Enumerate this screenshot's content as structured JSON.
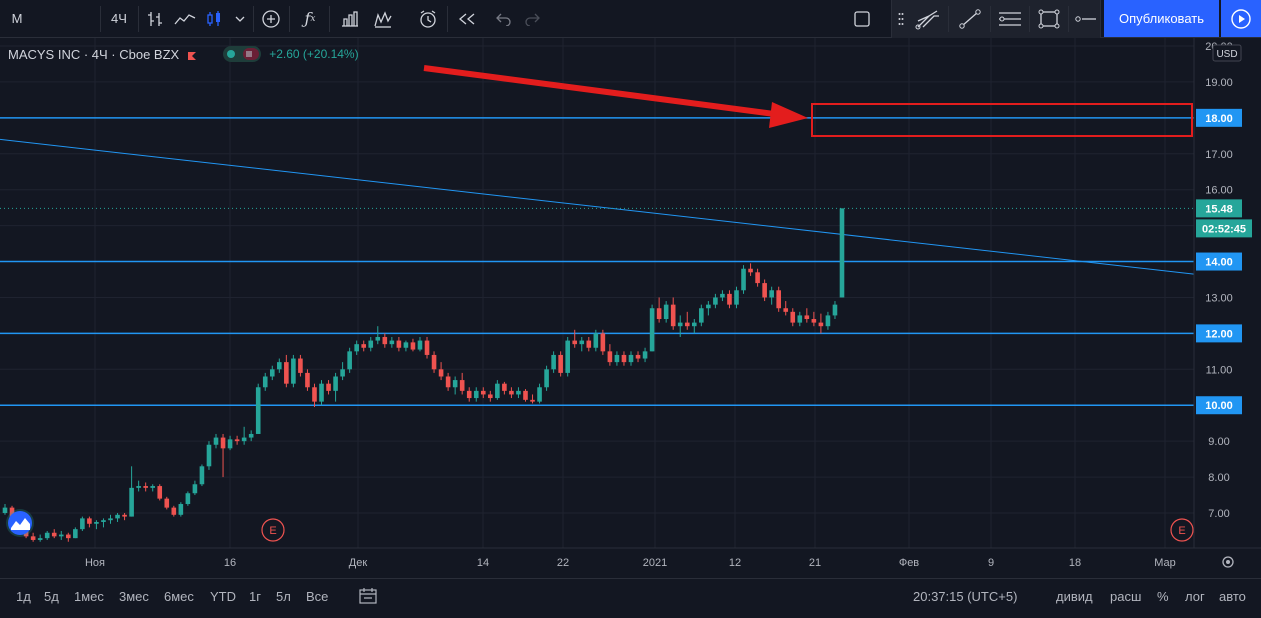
{
  "toolbar": {
    "symbol": "M",
    "interval": "4Ч",
    "publish_label": "Опубликовать",
    "icons": [
      "bar-style-icon",
      "line-style-icon",
      "candle-style-icon",
      "chevron-down-icon",
      "add-compare-icon",
      "indicators-icon",
      "financials-icon",
      "alert-icon",
      "alarm-clock-icon",
      "replay-icon",
      "undo-icon",
      "redo-icon",
      "square-icon"
    ]
  },
  "drawing_toolbar": {
    "icons": [
      "drag-handle-icon",
      "pitchfork-icon",
      "trendline-icon",
      "horizontal-ray-icon",
      "rectangle-icon",
      "horizontal-line-icon"
    ]
  },
  "legend": {
    "title": "MACYS INC · 4Ч · Cboe BZX",
    "change": "+2.60 (+20.14%)"
  },
  "price_axis": {
    "currency": "USD",
    "labels": [
      "20.00",
      "19.00",
      "18.00",
      "17.00",
      "16.00",
      "15.48",
      "14.00",
      "13.00",
      "12.00",
      "11.00",
      "10.00",
      "9.00",
      "8.00",
      "7.00"
    ],
    "last_price": "15.48",
    "countdown": "02:52:45",
    "highlighted": [
      "18.00",
      "14.00",
      "12.00",
      "10.00"
    ]
  },
  "time_axis": {
    "labels": [
      "Ноя",
      "16",
      "Дек",
      "14",
      "22",
      "2021",
      "12",
      "21",
      "Фев",
      "9",
      "18",
      "Мар"
    ]
  },
  "earnings_marker": "E",
  "bottom": {
    "ranges": [
      "1д",
      "5д",
      "1мес",
      "3мес",
      "6мес",
      "YTD",
      "1г",
      "5л",
      "Все"
    ],
    "time": "20:37:15 (UTC+5)",
    "options": [
      "дивид",
      "расш",
      "%",
      "лог",
      "авто"
    ]
  },
  "colors": {
    "background": "#131722",
    "up": "#26a69a",
    "down": "#ef5350",
    "level_line": "#2196f3",
    "annotation": "#e31d1d",
    "accent": "#2962ff"
  },
  "chart_data": {
    "type": "candlestick",
    "ylim": [
      6.2,
      20.3
    ],
    "horizontal_levels": [
      18.0,
      14.0,
      12.0,
      10.0
    ],
    "trend_line": [
      {
        "x": "Nov 2",
        "y": 17.4
      },
      {
        "x": "Feb 26",
        "y": 13.65
      }
    ],
    "last_price": 15.48,
    "candles": [
      [
        7.0,
        7.25,
        6.95,
        7.15
      ],
      [
        7.15,
        7.2,
        6.6,
        6.75
      ],
      [
        6.75,
        6.9,
        6.55,
        6.65
      ],
      [
        6.6,
        6.7,
        6.3,
        6.35
      ],
      [
        6.35,
        6.45,
        6.2,
        6.25
      ],
      [
        6.25,
        6.4,
        6.2,
        6.3
      ],
      [
        6.3,
        6.5,
        6.25,
        6.45
      ],
      [
        6.45,
        6.55,
        6.3,
        6.35
      ],
      [
        6.35,
        6.5,
        6.25,
        6.4
      ],
      [
        6.4,
        6.45,
        6.2,
        6.3
      ],
      [
        6.3,
        6.6,
        6.3,
        6.55
      ],
      [
        6.55,
        6.9,
        6.5,
        6.85
      ],
      [
        6.85,
        6.9,
        6.6,
        6.7
      ],
      [
        6.7,
        6.8,
        6.55,
        6.75
      ],
      [
        6.75,
        6.85,
        6.6,
        6.8
      ],
      [
        6.8,
        6.95,
        6.7,
        6.85
      ],
      [
        6.85,
        7.0,
        6.75,
        6.95
      ],
      [
        6.95,
        7.0,
        6.8,
        6.9
      ],
      [
        6.9,
        8.3,
        6.9,
        7.7
      ],
      [
        7.7,
        7.9,
        7.6,
        7.75
      ],
      [
        7.75,
        7.85,
        7.6,
        7.7
      ],
      [
        7.7,
        7.8,
        7.6,
        7.75
      ],
      [
        7.75,
        7.8,
        7.35,
        7.4
      ],
      [
        7.4,
        7.45,
        7.1,
        7.15
      ],
      [
        7.15,
        7.2,
        6.9,
        6.95
      ],
      [
        6.95,
        7.3,
        6.9,
        7.25
      ],
      [
        7.25,
        7.6,
        7.2,
        7.55
      ],
      [
        7.55,
        7.9,
        7.5,
        7.8
      ],
      [
        7.8,
        8.35,
        7.75,
        8.3
      ],
      [
        8.3,
        9.0,
        8.2,
        8.9
      ],
      [
        8.9,
        9.2,
        8.8,
        9.1
      ],
      [
        9.1,
        9.2,
        8.0,
        8.8
      ],
      [
        8.8,
        9.15,
        8.75,
        9.05
      ],
      [
        9.05,
        9.15,
        8.9,
        9.0
      ],
      [
        9.0,
        9.4,
        8.9,
        9.1
      ],
      [
        9.1,
        9.3,
        9.0,
        9.2
      ],
      [
        9.2,
        10.6,
        9.2,
        10.5
      ],
      [
        10.5,
        10.9,
        10.4,
        10.8
      ],
      [
        10.8,
        11.1,
        10.7,
        11.0
      ],
      [
        11.0,
        11.3,
        10.9,
        11.2
      ],
      [
        11.2,
        11.4,
        10.5,
        10.6
      ],
      [
        10.6,
        11.4,
        10.5,
        11.3
      ],
      [
        11.3,
        11.4,
        10.8,
        10.9
      ],
      [
        10.9,
        11.0,
        10.4,
        10.5
      ],
      [
        10.5,
        10.6,
        9.95,
        10.1
      ],
      [
        10.1,
        10.7,
        10.0,
        10.6
      ],
      [
        10.6,
        10.7,
        10.3,
        10.4
      ],
      [
        10.4,
        10.9,
        10.1,
        10.8
      ],
      [
        10.8,
        11.2,
        10.7,
        11.0
      ],
      [
        11.0,
        11.6,
        10.9,
        11.5
      ],
      [
        11.5,
        11.8,
        11.4,
        11.7
      ],
      [
        11.7,
        11.8,
        11.5,
        11.6
      ],
      [
        11.6,
        11.9,
        11.5,
        11.8
      ],
      [
        11.8,
        12.2,
        11.7,
        11.9
      ],
      [
        11.9,
        12.0,
        11.6,
        11.7
      ],
      [
        11.7,
        11.9,
        11.6,
        11.8
      ],
      [
        11.8,
        11.9,
        11.5,
        11.6
      ],
      [
        11.6,
        11.8,
        11.5,
        11.75
      ],
      [
        11.75,
        11.85,
        11.5,
        11.55
      ],
      [
        11.55,
        11.9,
        11.5,
        11.8
      ],
      [
        11.8,
        11.9,
        11.3,
        11.4
      ],
      [
        11.4,
        11.5,
        10.9,
        11.0
      ],
      [
        11.0,
        11.2,
        10.7,
        10.8
      ],
      [
        10.8,
        10.9,
        10.4,
        10.5
      ],
      [
        10.5,
        10.8,
        10.3,
        10.7
      ],
      [
        10.7,
        10.9,
        10.3,
        10.4
      ],
      [
        10.4,
        10.5,
        10.1,
        10.2
      ],
      [
        10.2,
        10.5,
        10.1,
        10.4
      ],
      [
        10.4,
        10.5,
        10.2,
        10.3
      ],
      [
        10.3,
        10.4,
        10.1,
        10.2
      ],
      [
        10.2,
        10.7,
        10.15,
        10.6
      ],
      [
        10.6,
        10.65,
        10.3,
        10.4
      ],
      [
        10.4,
        10.5,
        10.2,
        10.3
      ],
      [
        10.3,
        10.5,
        10.2,
        10.4
      ],
      [
        10.4,
        10.45,
        10.1,
        10.15
      ],
      [
        10.15,
        10.3,
        10.05,
        10.1
      ],
      [
        10.1,
        10.6,
        10.05,
        10.5
      ],
      [
        10.5,
        11.1,
        10.4,
        11.0
      ],
      [
        11.0,
        11.5,
        10.9,
        11.4
      ],
      [
        11.4,
        11.5,
        10.8,
        10.9
      ],
      [
        10.9,
        11.9,
        10.8,
        11.8
      ],
      [
        11.8,
        12.1,
        11.6,
        11.7
      ],
      [
        11.7,
        11.9,
        11.5,
        11.8
      ],
      [
        11.8,
        11.9,
        11.5,
        11.6
      ],
      [
        11.6,
        12.1,
        11.5,
        12.0
      ],
      [
        12.0,
        12.1,
        11.4,
        11.5
      ],
      [
        11.5,
        11.7,
        11.1,
        11.2
      ],
      [
        11.2,
        11.5,
        11.1,
        11.4
      ],
      [
        11.4,
        11.5,
        11.1,
        11.2
      ],
      [
        11.2,
        11.5,
        11.1,
        11.4
      ],
      [
        11.4,
        11.5,
        11.2,
        11.3
      ],
      [
        11.3,
        11.6,
        11.2,
        11.5
      ],
      [
        11.5,
        12.8,
        11.5,
        12.7
      ],
      [
        12.7,
        13.0,
        12.3,
        12.4
      ],
      [
        12.4,
        12.9,
        12.3,
        12.8
      ],
      [
        12.8,
        13.0,
        12.1,
        12.2
      ],
      [
        12.2,
        12.5,
        11.9,
        12.3
      ],
      [
        12.3,
        12.6,
        12.1,
        12.2
      ],
      [
        12.2,
        12.4,
        12.0,
        12.3
      ],
      [
        12.3,
        12.8,
        12.2,
        12.7
      ],
      [
        12.7,
        12.9,
        12.5,
        12.8
      ],
      [
        12.8,
        13.1,
        12.7,
        13.0
      ],
      [
        13.0,
        13.2,
        12.9,
        13.1
      ],
      [
        13.1,
        13.2,
        12.7,
        12.8
      ],
      [
        12.8,
        13.3,
        12.7,
        13.2
      ],
      [
        13.2,
        13.9,
        13.1,
        13.8
      ],
      [
        13.8,
        13.95,
        13.6,
        13.7
      ],
      [
        13.7,
        13.8,
        13.3,
        13.4
      ],
      [
        13.4,
        13.5,
        12.9,
        13.0
      ],
      [
        13.0,
        13.3,
        12.8,
        13.2
      ],
      [
        13.2,
        13.3,
        12.6,
        12.7
      ],
      [
        12.7,
        12.9,
        12.5,
        12.6
      ],
      [
        12.6,
        12.7,
        12.2,
        12.3
      ],
      [
        12.3,
        12.6,
        12.2,
        12.5
      ],
      [
        12.5,
        12.7,
        12.3,
        12.4
      ],
      [
        12.4,
        12.6,
        12.2,
        12.3
      ],
      [
        12.3,
        12.55,
        12.0,
        12.2
      ],
      [
        12.2,
        12.6,
        12.1,
        12.5
      ],
      [
        12.5,
        12.9,
        12.4,
        12.8
      ],
      [
        13.0,
        15.48,
        13.0,
        15.48
      ]
    ]
  }
}
